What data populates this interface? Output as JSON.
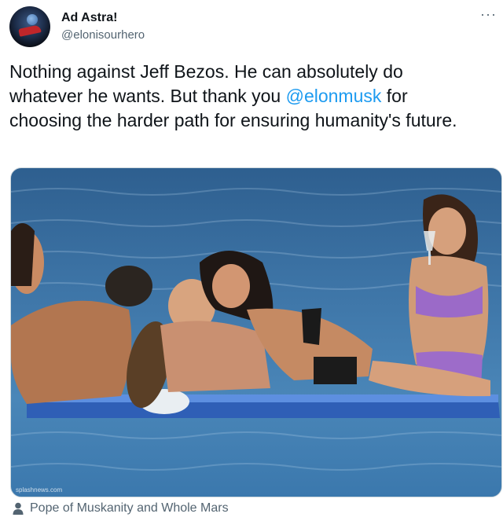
{
  "author": {
    "name": "Ad Astra!",
    "handle": "@elonisourhero"
  },
  "more_menu": "···",
  "tweet": {
    "text_before": "Nothing against Jeff Bezos. He can absolutely do whatever he wants. But thank you ",
    "mention": "@elonmusk",
    "text_after": " for choosing the harder path for ensuring humanity's future."
  },
  "media": {
    "watermark": "splashnews.com"
  },
  "tagged": {
    "people": "Pope of Muskanity and Whole Mars"
  },
  "colors": {
    "link": "#1d9bf0",
    "secondary_text": "#536471",
    "primary_text": "#0f1419"
  }
}
